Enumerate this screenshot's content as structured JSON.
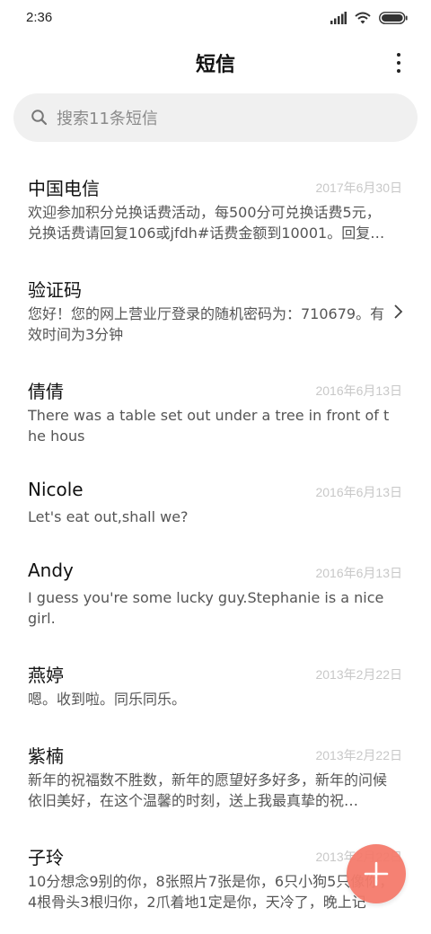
{
  "status_bar": {
    "time": "2:36"
  },
  "header": {
    "title": "短信"
  },
  "search": {
    "placeholder": "搜索11条短信"
  },
  "conversations": [
    {
      "name": "中国电信",
      "date": "2017年6月30日",
      "preview": "欢迎参加积分兑换话费活动，每500分可兑换话费5元，兑换话费请回复106或jfdh#话费金额到10001。回复…"
    },
    {
      "name": "验证码",
      "date": "",
      "preview": "您好！您的网上营业厅登录的随机密码为：710679。有效时间为3分钟"
    },
    {
      "name": "倩倩",
      "date": "2016年6月13日",
      "preview": "There was a table set out under a tree in front of the hous"
    },
    {
      "name": "Nicole",
      "date": "2016年6月13日",
      "preview": "Let's eat out,shall we?"
    },
    {
      "name": "Andy",
      "date": "2016年6月13日",
      "preview": "I guess you're some lucky guy.Stephanie is a nice girl."
    },
    {
      "name": "燕婷",
      "date": "2013年2月22日",
      "preview": "嗯。收到啦。同乐同乐。"
    },
    {
      "name": "紫楠",
      "date": "2013年2月22日",
      "preview": "新年的祝福数不胜数，新年的愿望好多好多，新年的问候依旧美好，在这个温馨的时刻，送上我最真挚的祝…"
    },
    {
      "name": "子玲",
      "date": "2013年2月22日",
      "preview": "10分想念9别的你，8张照片7张是你，6只小狗5只像你，4根骨头3根归你，2爪着地1定是你，天冷了，晚上记"
    }
  ],
  "colors": {
    "fab": "#f57b6c",
    "date": "#c8c8c8",
    "search_bg": "#f0f0f0"
  },
  "icons": [
    "signal-icon",
    "wifi-icon",
    "battery-icon",
    "more-icon",
    "search-icon",
    "chevron-right-icon",
    "plus-icon"
  ]
}
